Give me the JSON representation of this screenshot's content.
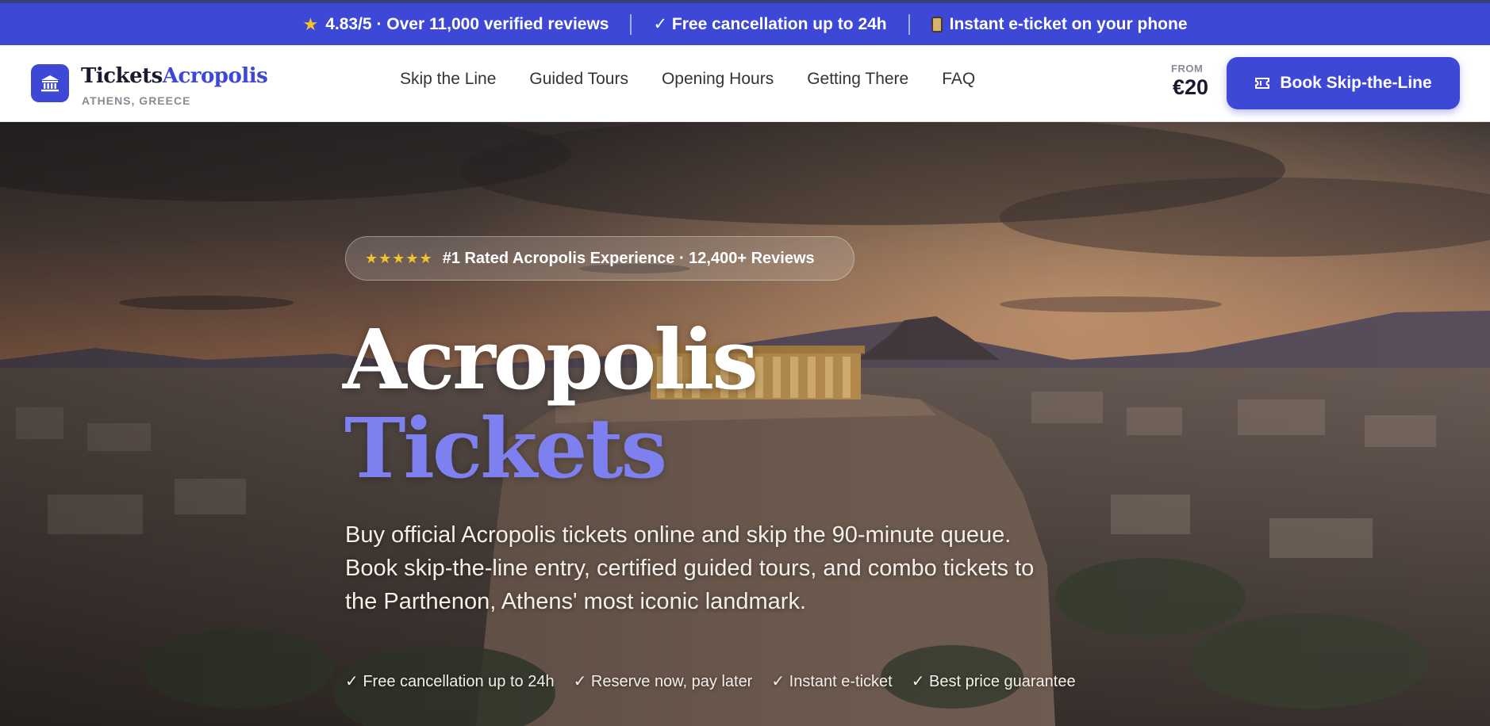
{
  "announcement": {
    "rating": "4.83/5 · Over 11,000 verified reviews",
    "cancellation": "✓ Free cancellation up to 24h",
    "eticket": "Instant e-ticket on your phone"
  },
  "header": {
    "logo_main": "Tickets",
    "logo_accent": "Acropolis",
    "logo_sub": "ATHENS, GREECE",
    "nav": [
      "Skip the Line",
      "Guided Tours",
      "Opening Hours",
      "Getting There",
      "FAQ"
    ],
    "from_label": "FROM",
    "from_price": "€20",
    "book_label": "Book Skip-the-Line"
  },
  "hero": {
    "pill_stars": "★★★★★",
    "pill_text": "#1 Rated Acropolis Experience · 12,400+ Reviews",
    "title_line1": "Acropolis",
    "title_line2": "Tickets",
    "description": "Buy official Acropolis tickets online and skip the 90-minute queue. Book skip-the-line entry, certified guided tours, and combo tickets to the Parthenon, Athens' most iconic landmark.",
    "perks": [
      "✓ Free cancellation up to 24h",
      "✓ Reserve now, pay later",
      "✓ Instant e-ticket",
      "✓ Best price guarantee"
    ]
  },
  "colors": {
    "brand": "#3d48d6",
    "title_accent": "#7e80ef",
    "star": "#f2c230"
  },
  "icons": [
    "star-icon",
    "phone-icon",
    "temple-icon",
    "ticket-icon",
    "five-stars-icon"
  ]
}
